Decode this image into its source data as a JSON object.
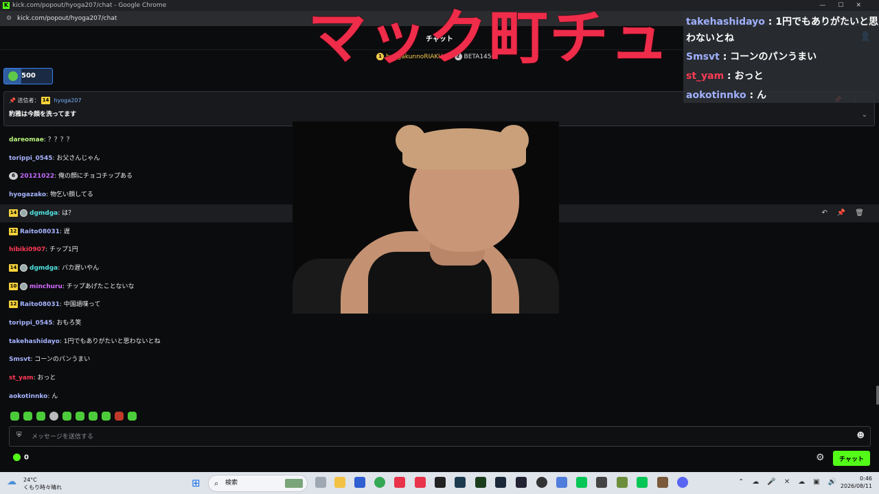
{
  "browser": {
    "window_title": "kick.com/popout/hyoga207/chat - Google Chrome",
    "url": "kick.com/popout/hyoga207/chat",
    "logo_letter": "K"
  },
  "chat_header": {
    "title": "チャット",
    "leaderboard": [
      {
        "rank": "1",
        "name": "hyogakunnoRIAKU"
      },
      {
        "rank": "2",
        "name": "BETA1456"
      }
    ]
  },
  "points_box": {
    "value": "500",
    "progress_percent": 35
  },
  "pinned": {
    "sent_by_label": "送信者：",
    "badge": "14",
    "username": "hyoga207",
    "message": "豹雅は今顔を洗ってます"
  },
  "messages": [
    {
      "user": "dareomae",
      "text": ": ？？？？",
      "color": "#b9f27c"
    },
    {
      "user": "torippi_0545",
      "text": ": お父さんじゃん",
      "color": "#a6b4ff"
    },
    {
      "badge": "6",
      "user": "20121022",
      "text": ": 俺の顔にチョコチップある",
      "color": "#c36bff"
    },
    {
      "user": "hyogazako",
      "text": ": 物乞い顔してる",
      "color": "#a6b4ff"
    },
    {
      "badge": "14",
      "user": "dgmdga",
      "text": ": は？",
      "color": "#4ee3e0"
    },
    {
      "badge": "12",
      "user": "Raito08031",
      "text": ": 遅",
      "color": "#a6b4ff"
    },
    {
      "user": "hibiki0907",
      "text": ": チップ1円",
      "color": "#ff3b56"
    },
    {
      "badge": "14",
      "user": "dgmdga",
      "text": ": バカ遅いやん",
      "color": "#4ee3e0"
    },
    {
      "badge": "10",
      "user": "minchuru",
      "text": ": チップあげたことないな",
      "color": "#d36bff"
    },
    {
      "badge": "12",
      "user": "Raito08031",
      "text": ": 中国語喋って",
      "color": "#a6b4ff"
    },
    {
      "user": "torippi_0545",
      "text": ": おもろ笑",
      "color": "#a6b4ff"
    },
    {
      "user": "takehashidayo",
      "text": ": 1円でもありがたいと思わないとね",
      "color": "#a6b4ff"
    },
    {
      "user": "Smsvt",
      "text": ": コーンのパンうまい",
      "color": "#a6b4ff"
    },
    {
      "user": "st_yam",
      "text": ": おっと",
      "color": "#ff3b56"
    },
    {
      "user": "aokotinnko",
      "text": ": ん",
      "color": "#a6b4ff"
    }
  ],
  "overlay": {
    "title": "マック町チュ",
    "chat": [
      {
        "user": "takehashidayo",
        "text": " : 1円でもありがたいと思"
      },
      {
        "user": "",
        "text": "わないとね"
      },
      {
        "user": "Smsvt",
        "text": " : コーンのパンうまい"
      },
      {
        "user": "st_yam",
        "text": " : おっと"
      },
      {
        "user": "aokotinnko",
        "text": " : ん"
      }
    ]
  },
  "input": {
    "placeholder": "メッセージを送信する"
  },
  "bottom": {
    "points": "0",
    "chat_button": "チャット"
  },
  "taskbar": {
    "temperature": "24°C",
    "weather": "くもり時々晴れ",
    "search_label": "検索",
    "time": "0:46",
    "date": "2026/08/11"
  }
}
